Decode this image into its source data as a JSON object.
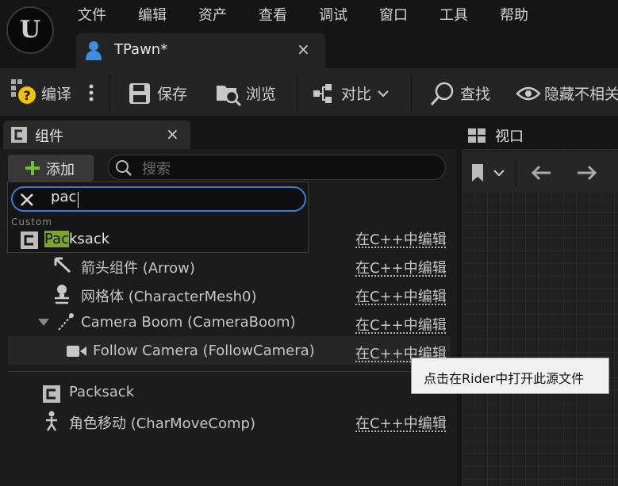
{
  "menu": [
    "文件",
    "编辑",
    "资产",
    "查看",
    "调试",
    "窗口",
    "工具",
    "帮助"
  ],
  "logo_text": "U",
  "tab": {
    "title": "TPawn*",
    "close": "×"
  },
  "toolbar": {
    "compile": "编译",
    "save": "保存",
    "browse": "浏览",
    "diff": "对比",
    "find": "查找",
    "hide": "隐藏不相关"
  },
  "components_panel": {
    "title": "组件",
    "close": "×",
    "add_button": "添加",
    "search_placeholder": "搜索"
  },
  "viewport_panel": {
    "title": "视口"
  },
  "dropdown": {
    "query": "pac",
    "category": "Custom",
    "result_highlight": "Pac",
    "result_rest": "ksack"
  },
  "rows": [
    {
      "label": "箭头组件 (Arrow)",
      "edit": "在C++中编辑"
    },
    {
      "label": "网格体 (CharacterMesh0)",
      "edit": "在C++中编辑"
    },
    {
      "label": "Camera Boom (CameraBoom)",
      "edit": "在C++中编辑"
    },
    {
      "label": "Follow Camera (FollowCamera)",
      "edit": "在C++中编辑"
    }
  ],
  "row0_edit": "在C++中编辑",
  "lower_rows": [
    {
      "label": "Packsack",
      "edit": ""
    },
    {
      "label": "角色移动 (CharMoveComp)",
      "edit": "在C++中编辑"
    }
  ],
  "tooltip": "点击在Rider中打开此源文件",
  "colors": {
    "accent_blue": "#2f7fd6",
    "highlight_green": "#7aa72a",
    "add_plus": "#6ec03a"
  }
}
